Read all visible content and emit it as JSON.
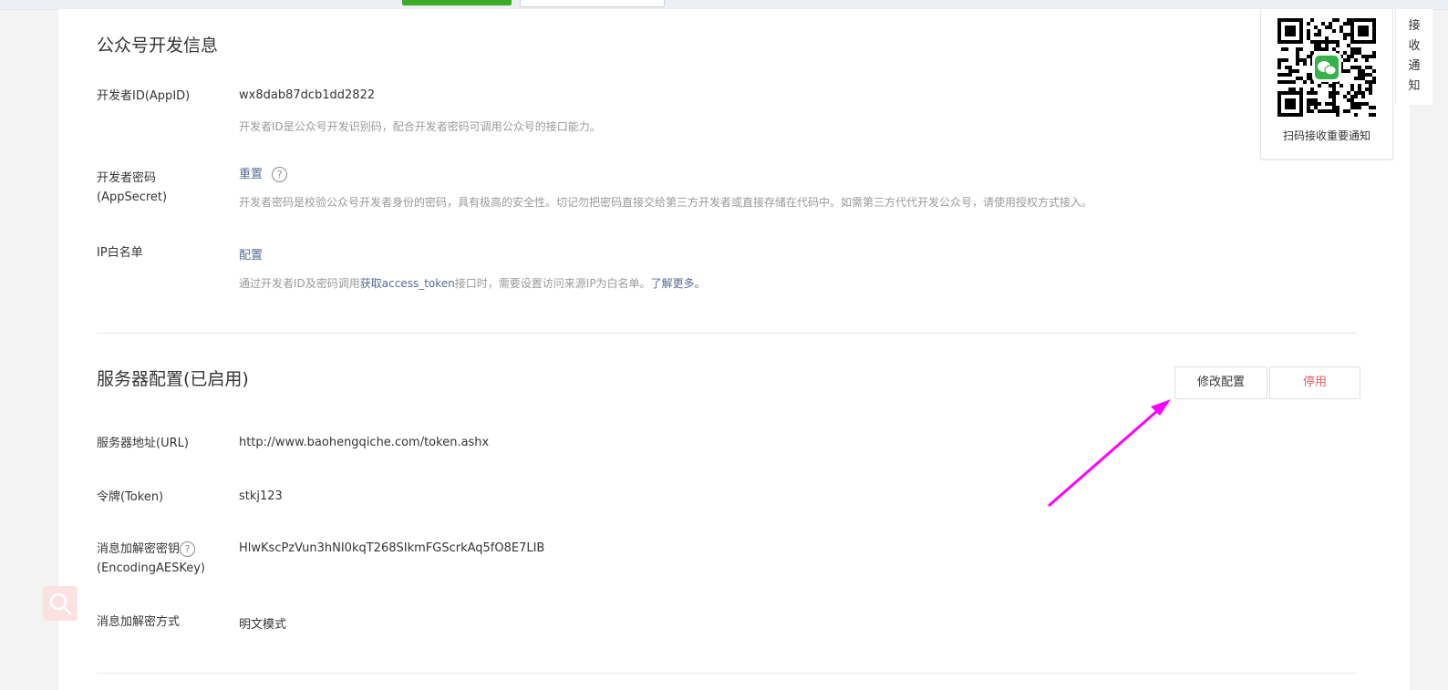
{
  "dev_info": {
    "title": "公众号开发信息",
    "appid": {
      "label": "开发者ID(AppID)",
      "value": "wx8dab87dcb1dd2822",
      "desc": "开发者ID是公众号开发识别码，配合开发者密码可调用公众号的接口能力。"
    },
    "appsecret": {
      "label_line1": "开发者密码",
      "label_line2": "(AppSecret)",
      "action": "重置",
      "desc": "开发者密码是校验公众号开发者身份的密码，具有极高的安全性。切记勿把密码直接交给第三方开发者或直接存储在代码中。如需第三方代代开发公众号，请使用授权方式接入。"
    },
    "ip_whitelist": {
      "label": "IP白名单",
      "action": "配置",
      "desc_prefix": "通过开发者ID及密码调用",
      "desc_link": "获取access_token",
      "desc_middle": "接口时，需要设置访问来源IP为白名单。",
      "desc_more": "了解更多。"
    }
  },
  "server_config": {
    "title": "服务器配置(已启用)",
    "modify_button": "修改配置",
    "disable_button": "停用",
    "url": {
      "label": "服务器地址(URL)",
      "value": "http://www.baohengqiche.com/token.ashx"
    },
    "token": {
      "label": "令牌(Token)",
      "value": "stkj123"
    },
    "aeskey": {
      "label_line1": "消息加解密密钥",
      "label_line2": "(EncodingAESKey)",
      "value": "HlwKscPzVun3hNI0kqT268SIkmFGScrkAq5fO8E7LIB"
    },
    "encrypt_mode": {
      "label": "消息加解密方式",
      "value": "明文模式"
    }
  },
  "qr_panel": {
    "caption": "扫码接收重要通知"
  },
  "side_tab": {
    "chars": [
      "接",
      "收",
      "通",
      "知"
    ]
  },
  "colors": {
    "link": "#576b95",
    "danger": "#e15f63",
    "annotation_arrow": "#ff00ff"
  },
  "icons": {
    "help": "help-circle-icon",
    "search": "search-icon",
    "qr": "qr-code-icon",
    "wechat": "wechat-icon"
  }
}
